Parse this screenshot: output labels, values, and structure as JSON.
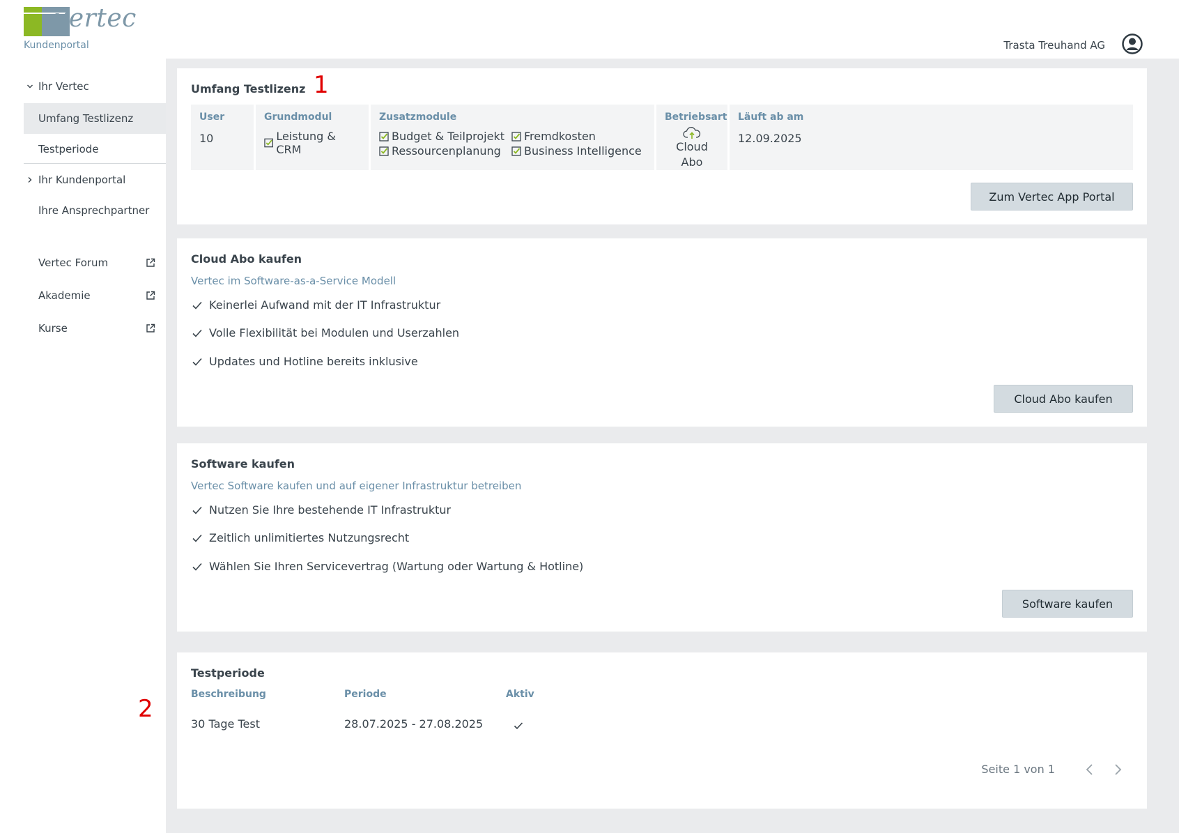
{
  "header": {
    "logo_text": "vertec",
    "logo_subtitle": "Kundenportal",
    "company": "Trasta Treuhand AG",
    "user_icon": "user-circle-icon"
  },
  "sidebar": {
    "items": [
      {
        "label": "Ihr Vertec",
        "icon": "chevron-down-icon"
      },
      {
        "label": "Umfang Testlizenz"
      },
      {
        "label": "Testperiode"
      },
      {
        "label": "Ihr Kundenportal",
        "icon": "chevron-right-icon"
      },
      {
        "label": "Ihre Ansprechpartner"
      },
      {
        "label": "Vertec Forum",
        "icon": "external-link-icon"
      },
      {
        "label": "Akademie",
        "icon": "external-link-icon"
      },
      {
        "label": "Kurse",
        "icon": "external-link-icon"
      }
    ]
  },
  "license": {
    "title": "Umfang Testlizenz",
    "marker": "1",
    "user_label": "User",
    "user_value": "10",
    "grundmodul_label": "Grundmodul",
    "grundmodul_value": "Leistung & CRM",
    "zusatz_label": "Zusatzmodule",
    "zusatz": [
      "Budget & Teilprojekt",
      "Fremdkosten",
      "Ressourcenplanung",
      "Business Intelligence"
    ],
    "betriebsart_label": "Betriebsart",
    "betriebsart_value": "Cloud Abo",
    "betriebsart_icon": "cloud-upload-icon",
    "ablauf_label": "Läuft ab am",
    "ablauf_value": "12.09.2025",
    "button": "Zum Vertec App Portal"
  },
  "cloud": {
    "title": "Cloud Abo kaufen",
    "subtitle": "Vertec im Software-as-a-Service Modell",
    "points": [
      "Keinerlei Aufwand mit der IT Infrastruktur",
      "Volle Flexibilität bei Modulen und Userzahlen",
      "Updates und Hotline bereits inklusive"
    ],
    "button": "Cloud Abo kaufen"
  },
  "software": {
    "title": "Software kaufen",
    "subtitle": "Vertec Software kaufen und auf eigener Infrastruktur betreiben",
    "points": [
      "Nutzen Sie Ihre bestehende IT Infrastruktur",
      "Zeitlich unlimitiertes Nutzungsrecht",
      "Wählen Sie Ihren Servicevertrag (Wartung oder Wartung & Hotline)"
    ],
    "button": "Software kaufen"
  },
  "testperiode": {
    "title": "Testperiode",
    "marker": "2",
    "col_beschreibung": "Beschreibung",
    "col_periode": "Periode",
    "col_aktiv": "Aktiv",
    "rows": [
      {
        "beschreibung": "30 Tage Test",
        "periode": "28.07.2025 - 27.08.2025",
        "aktiv": true
      }
    ],
    "pager": "Seite 1 von 1"
  },
  "colors": {
    "accent_green": "#8cb824",
    "accent_blue": "#7e98a8",
    "link_blue": "#6a8fa8",
    "button_bg": "#d3dbe0",
    "marker_red": "#e00000"
  }
}
